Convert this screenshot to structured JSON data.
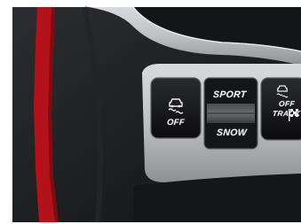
{
  "controls": {
    "vsc_off": {
      "icon": "skid-car-icon",
      "label": "OFF"
    },
    "drive_mode": {
      "top_label": "SPORT",
      "bottom_label": "SNOW"
    },
    "track_mode": {
      "icon": "skid-car-icon",
      "label_1": "OFF",
      "label_2": "TRACK",
      "flag_icon": "checkered-flag-icon"
    }
  },
  "colors": {
    "trim_red": "#b3121b",
    "panel_silver": "#c9cacd",
    "button_black": "#18191c"
  }
}
